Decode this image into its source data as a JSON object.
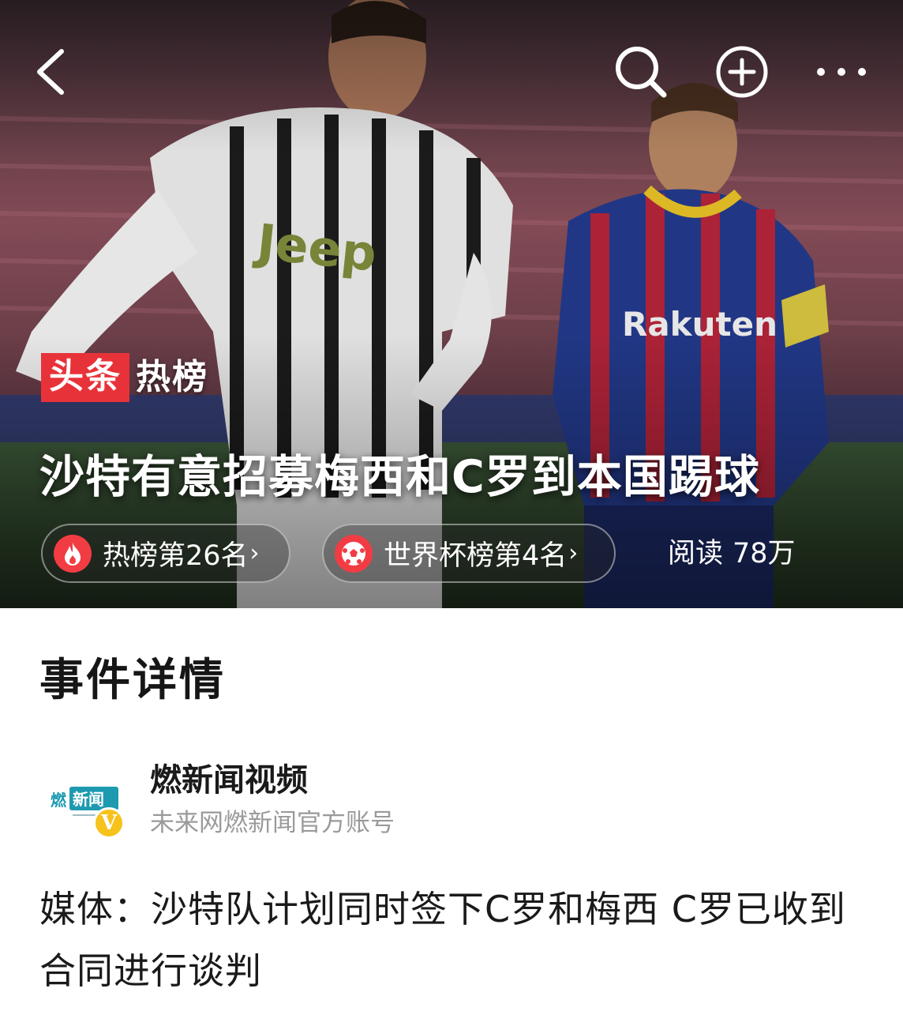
{
  "hero": {
    "brand_red": "头条",
    "brand_white": "热榜",
    "headline": "沙特有意招募梅西和C罗到本国踢球",
    "chips": [
      {
        "label": "热榜第26名",
        "icon": "flame-icon",
        "color": "#f23c44"
      },
      {
        "label": "世界杯榜第4名",
        "icon": "soccer-ball-icon",
        "color": "#f23c44"
      }
    ],
    "read_label": "阅读",
    "read_count": "78万"
  },
  "topbar": {
    "icons": [
      "back-icon",
      "search-icon",
      "add-icon",
      "more-icon"
    ]
  },
  "photo_text": {
    "jersey_left": "Jeep",
    "jersey_right": "Rakuten"
  },
  "main": {
    "section_title": "事件详情",
    "source": {
      "name": "燃新闻视频",
      "description": "未来网燃新闻官方账号",
      "logo_text": "燃新闻",
      "verified_mark": "V"
    },
    "summary": "媒体：沙特队计划同时签下C罗和梅西 C罗已收到合同进行谈判"
  },
  "colors": {
    "accent_red": "#e8323a",
    "verified_yellow": "#f6c21c",
    "logo_teal": "#1e9ab0"
  }
}
